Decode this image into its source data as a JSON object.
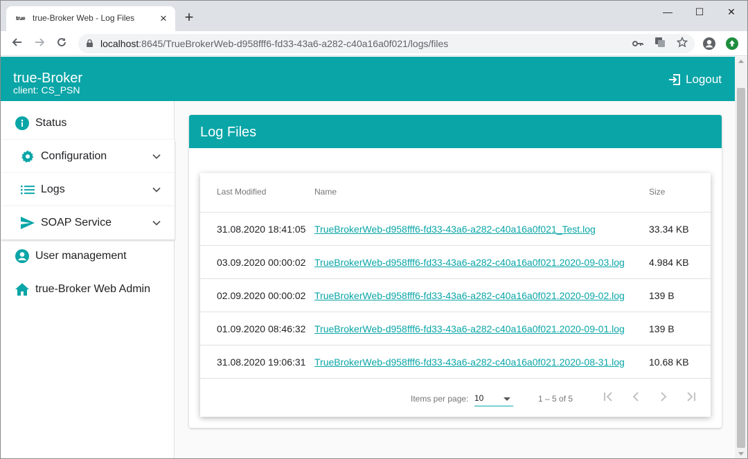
{
  "browser": {
    "tab_title": "true-Broker Web - Log Files",
    "favicon_text": "true",
    "tab_close": "×",
    "new_tab": "+",
    "window_controls": {
      "minimize": "—",
      "maximize": "☐",
      "close": "✕"
    },
    "url_host": "localhost",
    "url_rest": ":8645/TrueBrokerWeb-d958fff6-fd33-43a6-a282-c40a16a0f021/logs/files"
  },
  "app": {
    "brand": "true-Broker",
    "client": "client: CS_PSN",
    "logout_label": "Logout",
    "accent": "#0aa5a7"
  },
  "sidebar": {
    "items": [
      {
        "label": "Status",
        "icon": "info-icon"
      },
      {
        "label": "Configuration",
        "icon": "gear-icon",
        "expandable": true
      },
      {
        "label": "Logs",
        "icon": "list-icon",
        "expandable": true
      },
      {
        "label": "SOAP Service",
        "icon": "send-icon",
        "expandable": true
      },
      {
        "label": "User management",
        "icon": "account-circle-icon"
      },
      {
        "label": "true-Broker Web Admin",
        "icon": "home-icon"
      }
    ]
  },
  "main": {
    "title": "Log Files",
    "table": {
      "headers": {
        "modified": "Last Modified",
        "name": "Name",
        "size": "Size"
      },
      "rows": [
        {
          "modified": "31.08.2020 18:41:05",
          "name": "TrueBrokerWeb-d958fff6-fd33-43a6-a282-c40a16a0f021_Test.log",
          "size": "33.34 KB"
        },
        {
          "modified": "03.09.2020 00:00:02",
          "name": "TrueBrokerWeb-d958fff6-fd33-43a6-a282-c40a16a0f021.2020-09-03.log",
          "size": "4.984 KB"
        },
        {
          "modified": "02.09.2020 00:00:02",
          "name": "TrueBrokerWeb-d958fff6-fd33-43a6-a282-c40a16a0f021.2020-09-02.log",
          "size": "139 B"
        },
        {
          "modified": "01.09.2020 08:46:32",
          "name": "TrueBrokerWeb-d958fff6-fd33-43a6-a282-c40a16a0f021.2020-09-01.log",
          "size": "139 B"
        },
        {
          "modified": "31.08.2020 19:06:31",
          "name": "TrueBrokerWeb-d958fff6-fd33-43a6-a282-c40a16a0f021.2020-08-31.log",
          "size": "10.68 KB"
        }
      ]
    },
    "paginator": {
      "items_per_page_label": "Items per page:",
      "items_per_page_value": "10",
      "range": "1 – 5 of 5"
    }
  }
}
